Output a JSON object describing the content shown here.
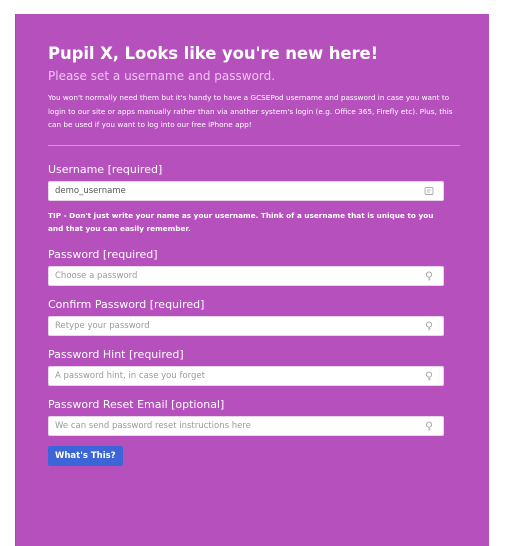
{
  "header": {
    "title": "Pupil X, Looks like you're new here!",
    "subtitle": "Please set a username and password.",
    "intro": "You won't normally need them but it's handy to have a GCSEPod username and password in case you want to login to our site or apps manually rather than via another system's login (e.g. Office 365, Firefly etc). Plus, this can be used if you want to log into our free iPhone app!"
  },
  "form": {
    "username": {
      "label": "Username [required]",
      "value": "demo_username",
      "icon": "card-icon"
    },
    "tip": "TIP - Don't just write your name as your username. Think of a username that is unique to you and that you can easily remember.",
    "password": {
      "label": "Password [required]",
      "placeholder": "Choose a password",
      "icon": "key-icon"
    },
    "confirm_password": {
      "label": "Confirm Password [required]",
      "placeholder": "Retype your password",
      "icon": "key-icon"
    },
    "password_hint": {
      "label": "Password Hint [required]",
      "placeholder": "A password hint, in case you forget",
      "icon": "key-icon"
    },
    "reset_email": {
      "label": "Password Reset Email [optional]",
      "placeholder": "We can send password reset instructions here",
      "icon": "key-icon"
    },
    "whats_this_label": "What's This?"
  },
  "colors": {
    "panel": "#b550bd",
    "button": "#3c66d8"
  }
}
